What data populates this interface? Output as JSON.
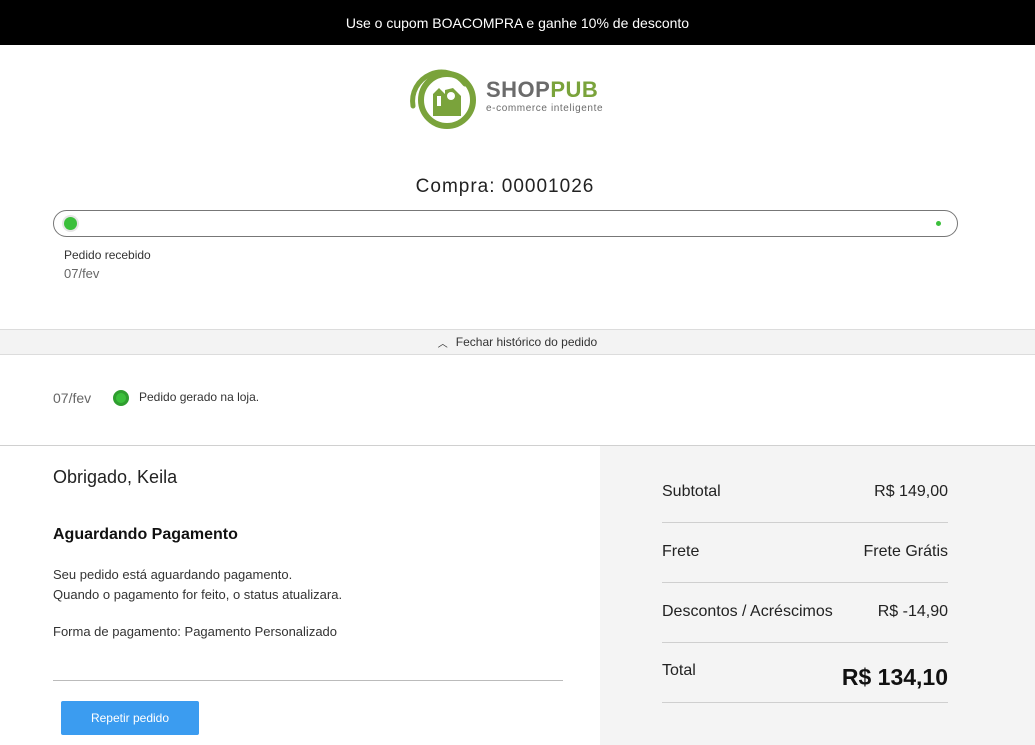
{
  "promo": {
    "text": "Use o cupom BOACOMPRA e ganhe 10% de desconto"
  },
  "brand": {
    "name_part1": "SHOP",
    "name_part2": "PUB",
    "tagline": "e-commerce inteligente",
    "logo_color": "#7aa33b"
  },
  "order": {
    "title": "Compra: 00001026",
    "progress": {
      "current_step_label": "Pedido recebido",
      "current_step_date": "07/fev"
    }
  },
  "history": {
    "toggle_label": "Fechar histórico do pedido",
    "entries": [
      {
        "date": "07/fev",
        "text": "Pedido gerado na loja."
      }
    ]
  },
  "details": {
    "thanks": "Obrigado, Keila",
    "status_title": "Aguardando Pagamento",
    "status_line1": "Seu pedido está aguardando pagamento.",
    "status_line2": "Quando o pagamento for feito, o status atualizara.",
    "payment_method": "Forma de pagamento: Pagamento Personalizado",
    "repeat_button": "Repetir pedido"
  },
  "summary": {
    "subtotal_label": "Subtotal",
    "subtotal_value": "R$ 149,00",
    "shipping_label": "Frete",
    "shipping_value": "Frete Grátis",
    "discount_label": "Descontos / Acréscimos",
    "discount_value": "R$ -14,90",
    "total_label": "Total",
    "total_value": "R$ 134,10"
  },
  "colors": {
    "accent_green": "#3bbf3b",
    "button_blue": "#3b9cf0",
    "promo_bg": "#000000"
  }
}
